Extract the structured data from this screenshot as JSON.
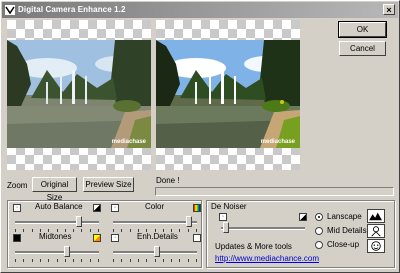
{
  "window": {
    "title": "Digital Camera Enhance 1.2"
  },
  "previews": {
    "watermark_left": "mediachase",
    "watermark_right": "mediachase"
  },
  "buttons": {
    "ok": "OK",
    "cancel": "Cancel",
    "original_size": "Original Size",
    "preview_size": "Preview Size"
  },
  "zoom_label": "Zoom",
  "status": {
    "text": "Done !",
    "progress": 0
  },
  "adjust": {
    "auto_balance": {
      "label": "Auto Balance",
      "level": 0.78
    },
    "color": {
      "label": "Color",
      "level": 0.93
    },
    "midtones": {
      "label": "Midtones",
      "level": 0.63
    },
    "enh_details": {
      "label": "Enh.Details",
      "level": 0.53
    }
  },
  "denoiser": {
    "label": "De Noiser",
    "level": 0.03,
    "modes": [
      {
        "label": "Lanscape",
        "selected": true
      },
      {
        "label": "Mid Details",
        "selected": false
      },
      {
        "label": "Close-up",
        "selected": false
      }
    ]
  },
  "updates": {
    "label": "Updates & More tools",
    "link": "http://www.mediachance.com"
  }
}
